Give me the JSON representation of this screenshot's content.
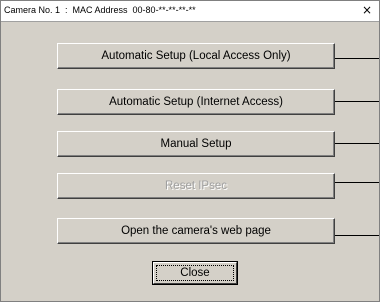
{
  "window": {
    "title": "Camera No. 1  :  MAC Address  00-80-**-**-**-**",
    "close_glyph": "×"
  },
  "actions": [
    {
      "label": "Automatic Setup (Local Access Only)",
      "enabled": true
    },
    {
      "label": "Automatic Setup (Internet Access)",
      "enabled": true
    },
    {
      "label": "Manual Setup",
      "enabled": true
    },
    {
      "label": "Reset IPsec",
      "enabled": false
    },
    {
      "label": "Open the camera's web page",
      "enabled": true
    }
  ],
  "footer": {
    "close_label": "Close"
  }
}
